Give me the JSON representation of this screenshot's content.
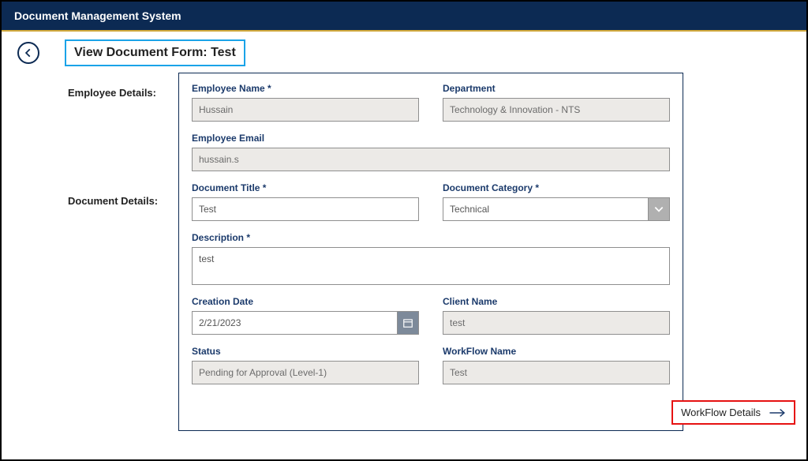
{
  "header": {
    "title": "Document Management System"
  },
  "page": {
    "title": "View Document Form: Test"
  },
  "sections": {
    "employee_label": "Employee Details:",
    "document_label": "Document Details:"
  },
  "employee": {
    "name_label": "Employee Name",
    "name_value": "Hussain",
    "dept_label": "Department",
    "dept_value": "Technology & Innovation - NTS",
    "email_label": "Employee Email",
    "email_value": "hussain.s"
  },
  "document": {
    "title_label": "Document Title",
    "title_value": "Test",
    "category_label": "Document Category",
    "category_value": "Technical",
    "description_label": "Description",
    "description_value": "test",
    "creation_label": "Creation Date",
    "creation_value": "2/21/2023",
    "client_label": "Client Name",
    "client_value": "test",
    "status_label": "Status",
    "status_value": "Pending for Approval (Level-1)",
    "workflow_label": "WorkFlow Name",
    "workflow_value": "Test"
  },
  "actions": {
    "workflow_details": "WorkFlow Details"
  }
}
